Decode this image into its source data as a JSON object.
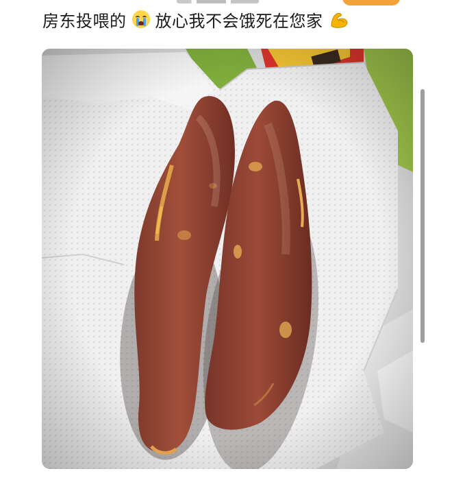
{
  "post": {
    "caption_part1": "房东投喂的",
    "caption_part2": "放心我不会饿死在您家",
    "emoji_1": "crying-face-icon",
    "emoji_2": "flexed-biceps-icon"
  },
  "photo": {
    "subject": "two-sweet-potatoes-on-paper-towel"
  }
}
